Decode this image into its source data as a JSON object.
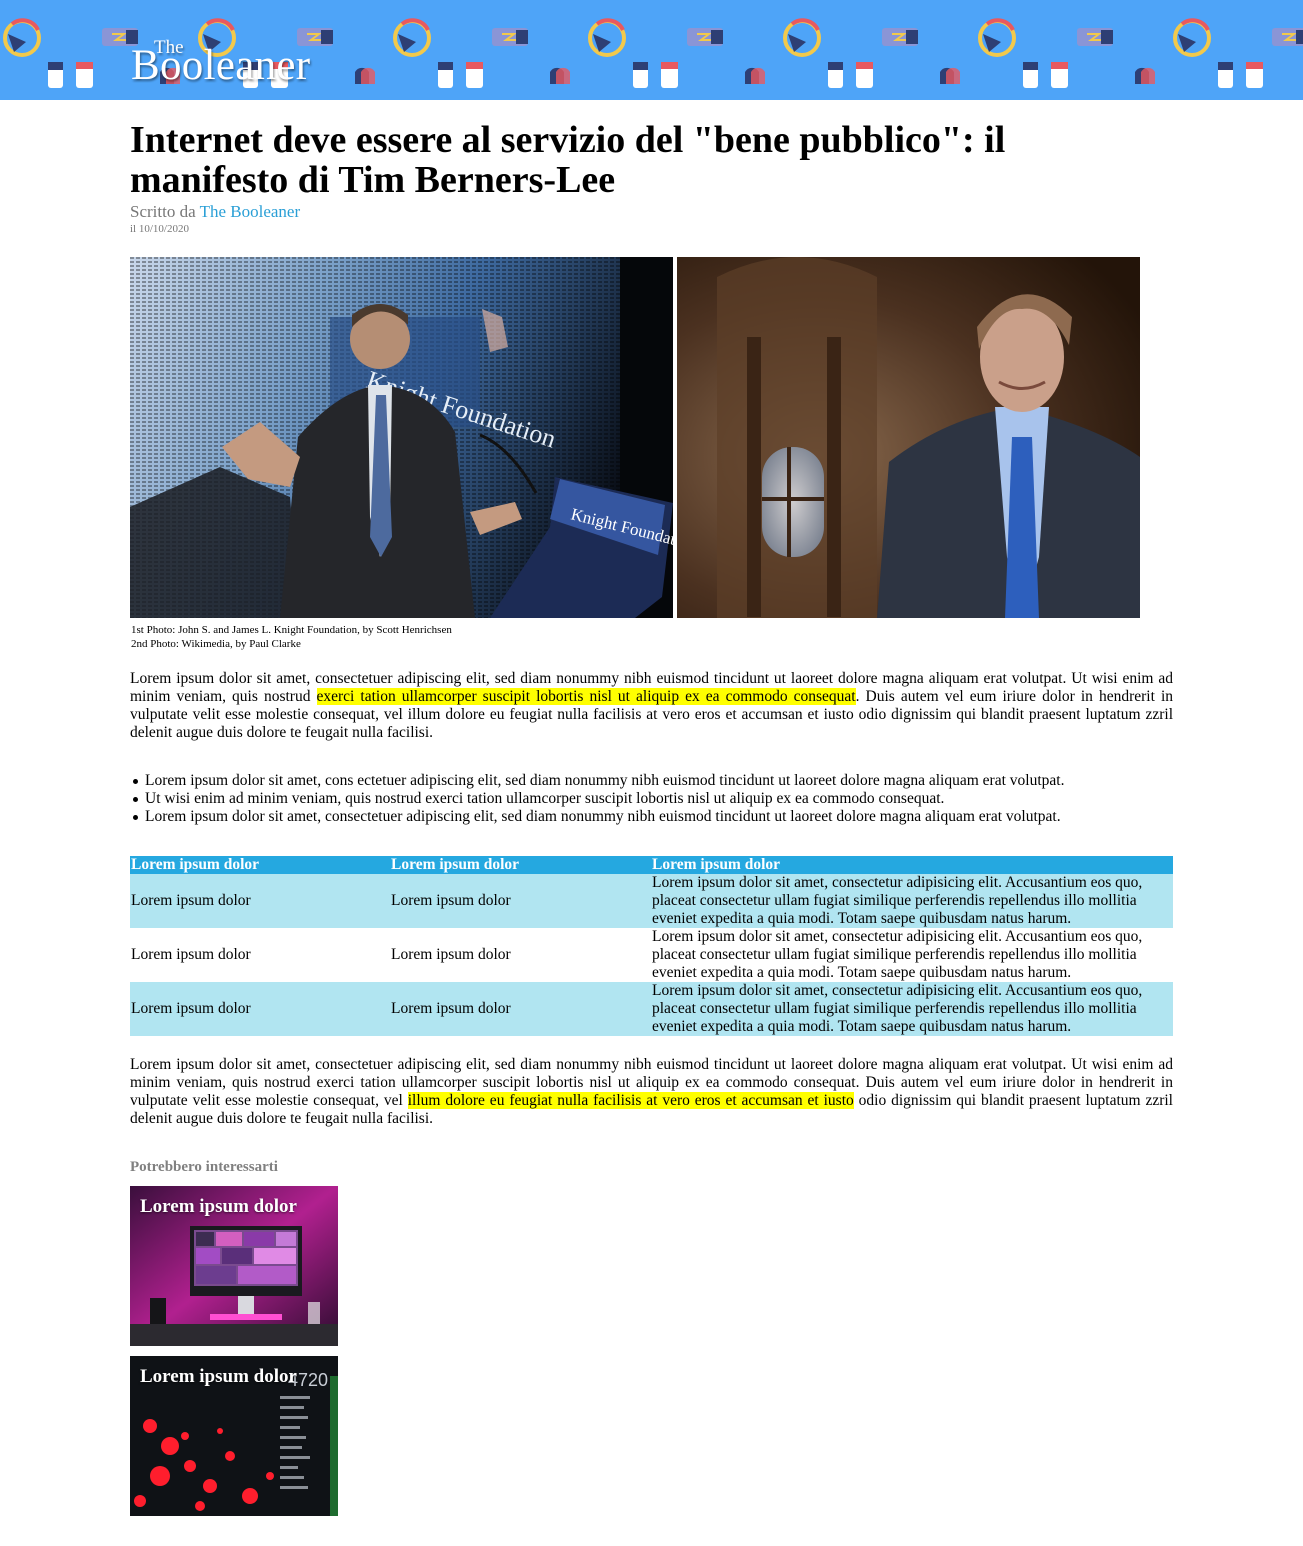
{
  "site": {
    "logo_the": "The",
    "logo_name": "Booleaner",
    "banner_color": "#4ea4f8"
  },
  "article": {
    "title": "Internet deve essere al servizio del \"bene pubblico\":  il manifesto di Tim Berners-Lee",
    "byline_prefix": "Scritto da",
    "author": "The Booleaner",
    "date": "il 10/10/2020",
    "photo_text_1": "Knight Foundation",
    "photo_text_2": "Knight Foundation",
    "caption_1": "1st Photo: John S. and James L. Knight Foundation, by Scott Henrichsen",
    "caption_2": "2nd Photo: Wikimedia, by Paul Clarke",
    "para1_before": "Lorem ipsum dolor sit amet, consectetuer adipiscing elit, sed diam nonummy nibh euismod tincidunt ut laoreet dolore magna aliquam erat volutpat. Ut wisi enim ad minim veniam, quis nostrud ",
    "para1_highlight": "exerci tation ullamcorper suscipit lobortis nisl ut aliquip ex ea commodo consequat",
    "para1_after": ". Duis autem vel eum iriure dolor in hendrerit in vulputate velit esse molestie consequat, vel illum dolore eu feugiat nulla facilisis at vero eros et accumsan et iusto odio dignissim qui blandit praesent luptatum zzril delenit augue duis dolore te feugait nulla facilisi.",
    "bullets": [
      "Lorem ipsum dolor sit amet, cons ectetuer adipiscing elit, sed diam nonummy nibh euismod tincidunt ut laoreet dolore magna aliquam erat volutpat.",
      "Ut wisi enim ad minim veniam, quis nostrud exerci tation ullamcorper suscipit lobortis nisl ut aliquip ex ea commodo consequat.",
      "Lorem ipsum dolor sit amet, consectetuer adipiscing elit, sed diam nonummy nibh euismod tincidunt ut laoreet dolore magna aliquam erat volutpat."
    ],
    "table": {
      "headers": [
        "Lorem ipsum dolor",
        "Lorem ipsum dolor",
        "Lorem ipsum dolor"
      ],
      "rows": [
        [
          "Lorem ipsum dolor",
          "Lorem ipsum dolor",
          "Lorem ipsum dolor sit amet, consectetur adipisicing elit. Accusantium eos quo, placeat consectetur ullam fugiat similique perferendis repellendus illo mollitia eveniet expedita a quia modi. Totam saepe quibusdam natus harum."
        ],
        [
          "Lorem ipsum dolor",
          "Lorem ipsum dolor",
          "Lorem ipsum dolor sit amet, consectetur adipisicing elit. Accusantium eos quo, placeat consectetur ullam fugiat similique perferendis repellendus illo mollitia eveniet expedita a quia modi. Totam saepe quibusdam natus harum."
        ],
        [
          "Lorem ipsum dolor",
          "Lorem ipsum dolor",
          "Lorem ipsum dolor sit amet, consectetur adipisicing elit. Accusantium eos quo, placeat consectetur ullam fugiat similique perferendis repellendus illo mollitia eveniet expedita a quia modi. Totam saepe quibusdam natus harum."
        ]
      ],
      "header_color": "#25a8e0",
      "stripe_color": "#b1e5f1"
    },
    "para2_before": "Lorem ipsum dolor sit amet, consectetuer adipiscing elit, sed diam nonummy nibh euismod tincidunt ut laoreet dolore magna aliquam erat volutpat. Ut wisi enim ad minim veniam, quis nostrud exerci tation ullamcorper suscipit lobortis nisl ut aliquip ex ea commodo consequat. Duis autem vel eum iriure dolor in hendrerit in vulputate velit esse molestie consequat, vel ",
    "para2_highlight": "illum dolore eu feugiat nulla facilisis at vero eros et accumsan et iusto",
    "para2_after": " odio dignissim qui blandit praesent luptatum zzril delenit augue duis dolore te feugait nulla facilisi.",
    "highlight_color": "#ffff00"
  },
  "related": {
    "title": "Potrebbero interessarti",
    "cards": [
      {
        "title": "Lorem ipsum dolor"
      },
      {
        "title": "Lorem ipsum dolor",
        "overlay_number": "4720"
      }
    ]
  }
}
